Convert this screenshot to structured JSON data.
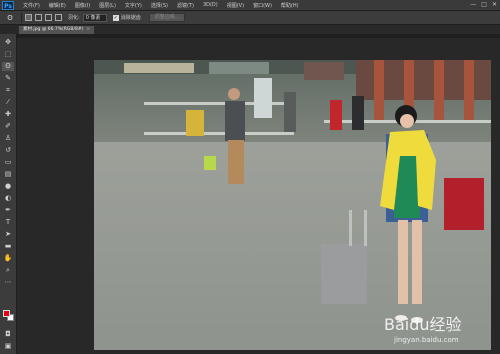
{
  "menu": {
    "logo": "Ps",
    "items": [
      "文件(F)",
      "编辑(E)",
      "图像(I)",
      "图层(L)",
      "文字(Y)",
      "选择(S)",
      "滤镜(T)",
      "3D(D)",
      "视图(V)",
      "窗口(W)",
      "帮助(H)"
    ]
  },
  "window_controls": {
    "minimize": "—",
    "maximize": "□",
    "close": "✕"
  },
  "options": {
    "tool_glyph": "ʘ",
    "feather_label": "羽化:",
    "feather_value": "0 像素",
    "antialias_label": "消除锯齿",
    "refine_edge_label": "调整边缘..."
  },
  "document_tab": {
    "title": "素材.jpg @ 66.7%(RGB/8#)",
    "close": "×"
  },
  "colors": {
    "foreground": "#e60012",
    "background": "#ffffff"
  },
  "watermark": {
    "brand": "Baidu经验",
    "url": "jingyan.baidu.com"
  }
}
